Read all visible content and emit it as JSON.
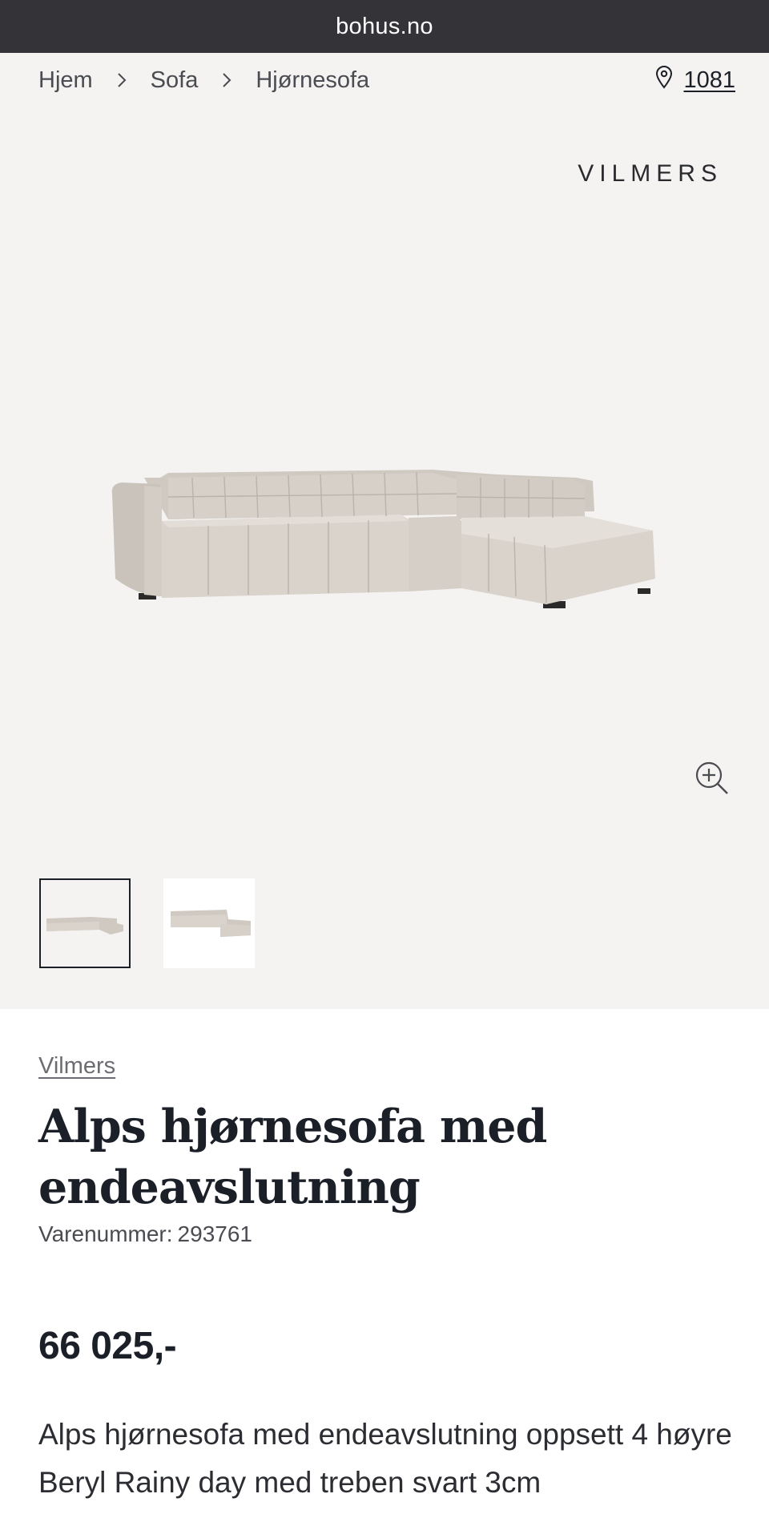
{
  "browser": {
    "url": "bohus.no"
  },
  "breadcrumb": [
    "Hjem",
    "Sofa",
    "Hjørnesofa"
  ],
  "store": {
    "number": "1081"
  },
  "brand": {
    "logo_text": "VILMERS",
    "link": "Vilmers"
  },
  "product": {
    "title_line1": "Alps hjørnesofa med",
    "title_line2": "endeavslutning",
    "sku_label": "Varenummer:",
    "sku": "293761",
    "price": "66 025,-",
    "description": "Alps hjørnesofa med endeavslutning oppsett 4 høyre Beryl Rainy day med treben svart 3cm"
  },
  "gallery": {
    "thumbnails": 2,
    "selected": 1
  },
  "colors": {
    "url_bar": "#333338",
    "hero_bg": "#f5f3f1",
    "text": "#1b1f27",
    "sofa": "#d4cec7"
  },
  "icons": [
    "chevron-right-icon",
    "location-pin-icon",
    "zoom-in-icon"
  ]
}
